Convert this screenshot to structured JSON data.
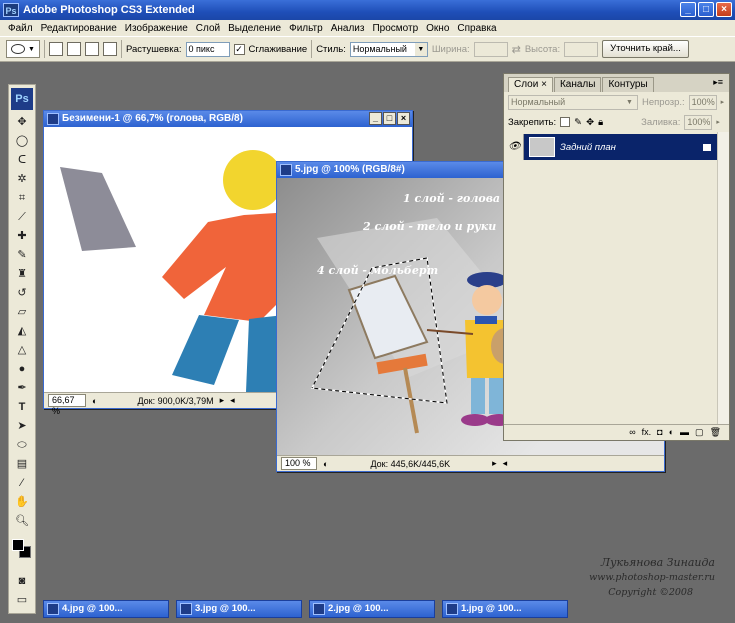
{
  "app": {
    "title": "Adobe Photoshop CS3 Extended",
    "icon": "Ps"
  },
  "window_buttons": [
    "_",
    "□",
    "×"
  ],
  "menu": [
    "Файл",
    "Редактирование",
    "Изображение",
    "Слой",
    "Выделение",
    "Фильтр",
    "Анализ",
    "Просмотр",
    "Окно",
    "Справка"
  ],
  "options": {
    "feather_label": "Растушевка:",
    "feather_value": "0 пикс",
    "antialias_label": "Сглаживание",
    "antialias_checked": true,
    "style_label": "Стиль:",
    "style_value": "Нормальный",
    "width_label": "Ширина:",
    "height_label": "Высота:",
    "refine_button": "Уточнить край..."
  },
  "tools": {
    "ps_logo": "Ps"
  },
  "doc1": {
    "title": "Безимени-1 @ 66,7% (голова, RGB/8)",
    "zoom": "66,67 %",
    "status": "Док: 900,0K/3,79M"
  },
  "doc2": {
    "title": "5.jpg @ 100% (RGB/8#)",
    "zoom": "100 %",
    "status": "Док: 445,6K/445,6K",
    "labels": [
      "1 слой - голова",
      "2 слой - тело и руки",
      "4 слой - мольберт"
    ]
  },
  "layers": {
    "tabs": [
      "Слои ×",
      "Каналы",
      "Контуры"
    ],
    "blend_mode": "Нормальный",
    "opacity_label": "Непрозр.:",
    "opacity_value": "100%",
    "lock_label": "Закрепить:",
    "fill_label": "Заливка:",
    "fill_value": "100%",
    "layer_name": "Задний план",
    "footer_icons": [
      "link-icon",
      "fx-icon",
      "mask-icon",
      "adjustment-icon",
      "group-icon",
      "new-layer-icon",
      "trash-icon"
    ]
  },
  "minimized": [
    {
      "title": "4.jpg @ 100..."
    },
    {
      "title": "3.jpg @ 100..."
    },
    {
      "title": "2.jpg @ 100..."
    },
    {
      "title": "1.jpg @ 100..."
    }
  ],
  "signature": {
    "name": "Лукьянова Зинаида",
    "url": "www.photoshop-master.ru",
    "copyright": "Copyright ©2008"
  },
  "colors": {
    "head": "#f2d52e",
    "body": "#f0643a",
    "legs": "#2d7fb4",
    "easel": "#8d8c98",
    "selection_bg": "#0a246a"
  }
}
